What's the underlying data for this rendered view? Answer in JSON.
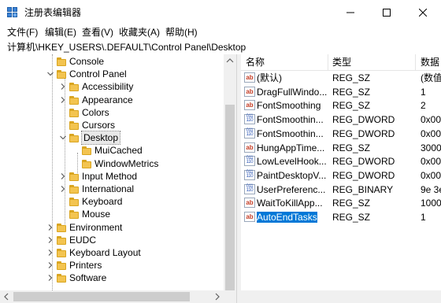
{
  "window": {
    "title": "注册表编辑器",
    "minimize_icon": "minimize-icon",
    "maximize_icon": "maximize-icon",
    "close_icon": "close-icon"
  },
  "menu": [
    "文件(F)",
    "编辑(E)",
    "查看(V)",
    "收藏夹(A)",
    "帮助(H)"
  ],
  "address": "计算机\\HKEY_USERS\\.DEFAULT\\Control Panel\\Desktop",
  "tree": {
    "items": [
      {
        "label": "Console",
        "expander": "none"
      },
      {
        "label": "Control Panel",
        "expander": "expanded"
      },
      {
        "label": "Accessibility",
        "expander": "collapsed"
      },
      {
        "label": "Appearance",
        "expander": "collapsed"
      },
      {
        "label": "Colors",
        "expander": "none"
      },
      {
        "label": "Cursors",
        "expander": "none"
      },
      {
        "label": "Desktop",
        "expander": "expanded",
        "selected": true
      },
      {
        "label": "MuiCached",
        "expander": "none"
      },
      {
        "label": "WindowMetrics",
        "expander": "none"
      },
      {
        "label": "Input Method",
        "expander": "collapsed"
      },
      {
        "label": "International",
        "expander": "collapsed"
      },
      {
        "label": "Keyboard",
        "expander": "none"
      },
      {
        "label": "Mouse",
        "expander": "none"
      },
      {
        "label": "Environment",
        "expander": "collapsed"
      },
      {
        "label": "EUDC",
        "expander": "collapsed"
      },
      {
        "label": "Keyboard Layout",
        "expander": "collapsed"
      },
      {
        "label": "Printers",
        "expander": "collapsed"
      },
      {
        "label": "Software",
        "expander": "collapsed"
      }
    ]
  },
  "list": {
    "columns": [
      "名称",
      "类型",
      "数据"
    ],
    "rows": [
      {
        "name": "(默认)",
        "type": "REG_SZ",
        "data": "(数值",
        "icon": "ab"
      },
      {
        "name": "DragFullWindo...",
        "type": "REG_SZ",
        "data": "1",
        "icon": "ab"
      },
      {
        "name": "FontSmoothing",
        "type": "REG_SZ",
        "data": "2",
        "icon": "ab"
      },
      {
        "name": "FontSmoothin...",
        "type": "REG_DWORD",
        "data": "0x00",
        "icon": "bin"
      },
      {
        "name": "FontSmoothin...",
        "type": "REG_DWORD",
        "data": "0x00",
        "icon": "bin"
      },
      {
        "name": "HungAppTime...",
        "type": "REG_SZ",
        "data": "3000",
        "icon": "ab"
      },
      {
        "name": "LowLevelHook...",
        "type": "REG_DWORD",
        "data": "0x00",
        "icon": "bin"
      },
      {
        "name": "PaintDesktopV...",
        "type": "REG_DWORD",
        "data": "0x00",
        "icon": "bin"
      },
      {
        "name": "UserPreferenc...",
        "type": "REG_BINARY",
        "data": "9e 3e",
        "icon": "bin"
      },
      {
        "name": "WaitToKillApp...",
        "type": "REG_SZ",
        "data": "1000",
        "icon": "ab"
      },
      {
        "name": "AutoEndTasks",
        "type": "REG_SZ",
        "data": "1",
        "icon": "ab",
        "selected": true
      }
    ]
  },
  "colors": {
    "selection": "#0078d7",
    "folder": "#f3c450"
  }
}
